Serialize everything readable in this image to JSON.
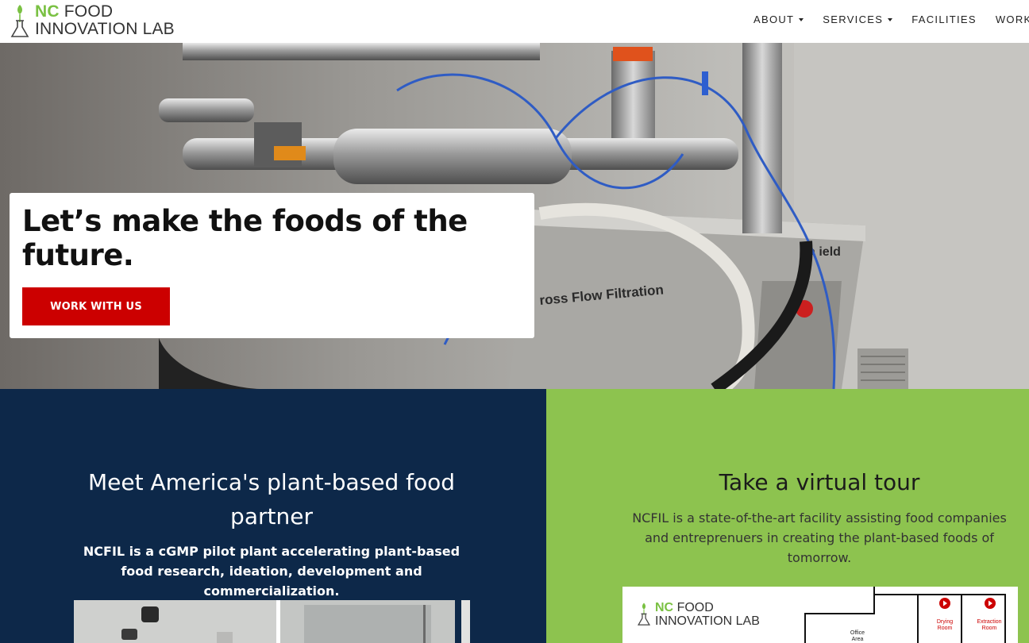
{
  "header": {
    "logo": {
      "nc": "NC",
      "line1": "FOOD",
      "line2": "INNOVATION LAB"
    },
    "nav": [
      {
        "label": "ABOUT",
        "dropdown": true
      },
      {
        "label": "SERVICES",
        "dropdown": true
      },
      {
        "label": "FACILITIES",
        "dropdown": false
      },
      {
        "label": "WORK W",
        "dropdown": false
      }
    ]
  },
  "hero": {
    "title": "Let’s make the foods of the future.",
    "cta_label": "WORK WITH US",
    "image_text": {
      "machine_label": "ross Flow Filtration",
      "brand_fragment": "a  ield"
    }
  },
  "left_panel": {
    "heading": "Meet America's plant-based food partner",
    "description": "NCFIL is a cGMP pilot plant accelerating plant-based food research, ideation, development and commercialization."
  },
  "right_panel": {
    "heading": "Take a virtual tour",
    "description": "NCFIL is a state-of-the-art facility assisting food companies and entreprenuers in creating the plant-based foods of tomorrow.",
    "tour_card": {
      "logo": {
        "nc": "NC",
        "line1": "FOOD",
        "line2": "INNOVATION LAB"
      },
      "rooms": [
        "Drying Room",
        "Extraction Room"
      ],
      "office_label": "Office Area"
    }
  },
  "colors": {
    "brand_green": "#7ac143",
    "cta_red": "#cc0000",
    "navy": "#0d2849",
    "panel_green": "#8dc34f"
  }
}
